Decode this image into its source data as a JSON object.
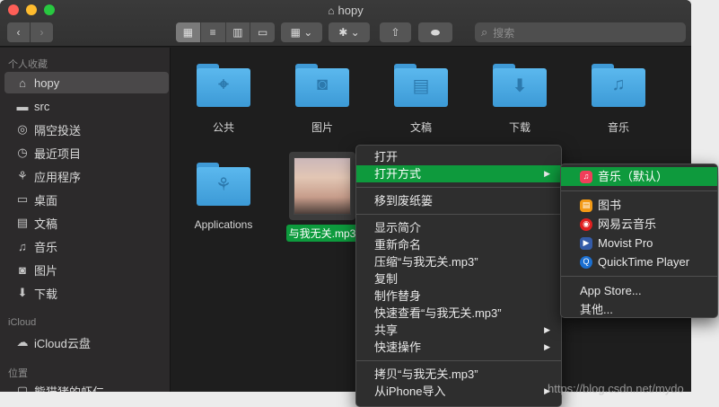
{
  "window": {
    "title": "hopy",
    "title_icon": "home-icon"
  },
  "toolbar": {
    "back": "‹",
    "forward": "›",
    "view_modes": [
      "▦",
      "≡",
      "▥",
      "▭"
    ],
    "group_icon": "▦ ⌄",
    "action_icon": "✱ ⌄",
    "share_icon": "⇧",
    "tag_icon": "⬬",
    "search_placeholder": "搜索",
    "search_icon": "⌕"
  },
  "sidebar": {
    "favorites_header": "个人收藏",
    "favorites": [
      {
        "label": "hopy",
        "icon": "⌂",
        "active": true
      },
      {
        "label": "src",
        "icon": "▬"
      },
      {
        "label": "隔空投送",
        "icon": "◎"
      },
      {
        "label": "最近项目",
        "icon": "◷"
      },
      {
        "label": "应用程序",
        "icon": "⚘"
      },
      {
        "label": "桌面",
        "icon": "▭"
      },
      {
        "label": "文稿",
        "icon": "▤"
      },
      {
        "label": "音乐",
        "icon": "♫"
      },
      {
        "label": "图片",
        "icon": "◙"
      },
      {
        "label": "下载",
        "icon": "⬇"
      }
    ],
    "icloud_header": "iCloud",
    "icloud": [
      {
        "label": "iCloud云盘",
        "icon": "☁"
      }
    ],
    "locations_header": "位置",
    "locations": [
      {
        "label": "熊猫猪的虾仁",
        "icon": "▢"
      }
    ]
  },
  "files": [
    {
      "label": "公共",
      "glyph": "⌖"
    },
    {
      "label": "图片",
      "glyph": "◙"
    },
    {
      "label": "文稿",
      "glyph": "▤"
    },
    {
      "label": "下载",
      "glyph": "⬇"
    },
    {
      "label": "音乐",
      "glyph": "♫"
    },
    {
      "label": "Applications",
      "glyph": "⚘"
    },
    {
      "label": "与我无关.mp3",
      "selected": true
    }
  ],
  "context_menu": {
    "items": [
      {
        "label": "打开"
      },
      {
        "label": "打开方式",
        "submenu": true,
        "highlighted": true
      },
      {
        "separator": true
      },
      {
        "label": "移到废纸篓"
      },
      {
        "separator": true
      },
      {
        "label": "显示简介"
      },
      {
        "label": "重新命名"
      },
      {
        "label": "压缩“与我无关.mp3”"
      },
      {
        "label": "复制"
      },
      {
        "label": "制作替身"
      },
      {
        "label": "快速查看“与我无关.mp3”"
      },
      {
        "label": "共享",
        "submenu": true
      },
      {
        "label": "快速操作",
        "submenu": true
      },
      {
        "separator": true
      },
      {
        "label": "拷贝“与我无关.mp3”"
      },
      {
        "label": "从iPhone导入",
        "submenu": true
      }
    ],
    "arrow": "▶"
  },
  "open_with_menu": {
    "items": [
      {
        "label": "音乐（默认）",
        "icon": "♫",
        "highlighted": true
      },
      {
        "separator": true
      },
      {
        "label": "图书",
        "icon": "▤"
      },
      {
        "label": "网易云音乐",
        "icon": "◉"
      },
      {
        "label": "Movist Pro",
        "icon": "▶"
      },
      {
        "label": "QuickTime Player",
        "icon": "Q"
      },
      {
        "separator": true
      },
      {
        "label": "App Store..."
      },
      {
        "label": "其他..."
      }
    ]
  },
  "watermark": "https://blog.csdn.net/mydo"
}
